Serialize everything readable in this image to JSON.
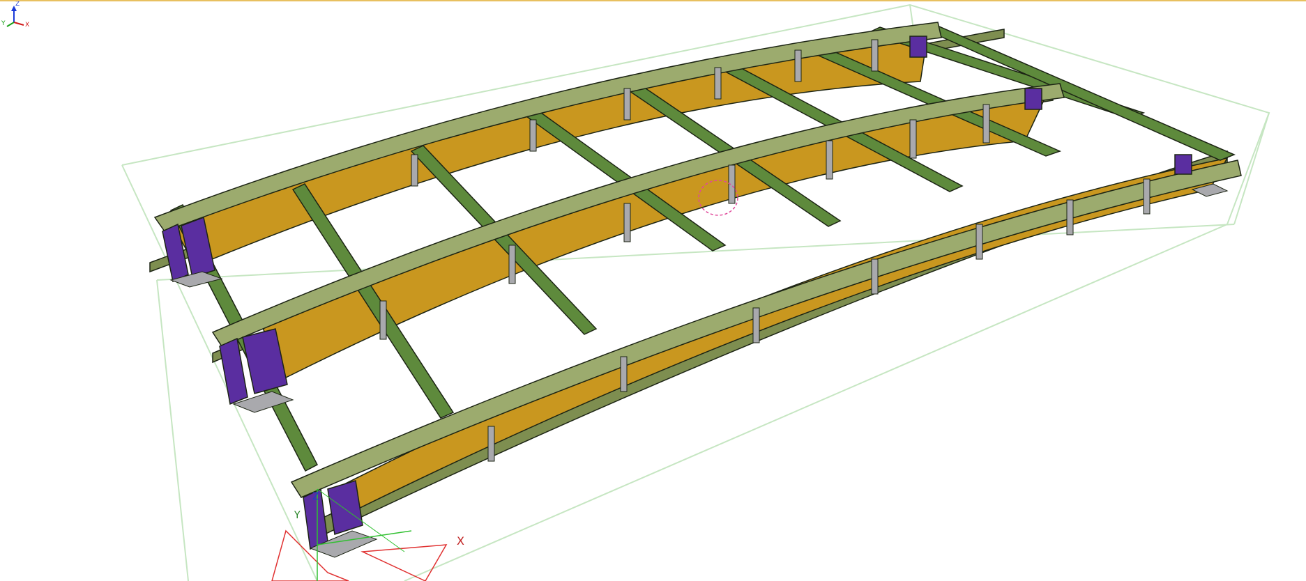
{
  "viewport": {
    "colors": {
      "web": "#c9971f",
      "top_flange": "#9cab6e",
      "secondary_beam": "#5e8a3c",
      "beam_dark": "#3c5a24",
      "end_plate": "#5a2ea0",
      "stiffener": "#a9a9ad",
      "bounding_box": "#c6e6c2",
      "outline": "#1c2414",
      "selection": "#e0489a"
    },
    "axis_labels": {
      "x": "X",
      "y": "Y",
      "z": "Z"
    },
    "view_triad": {
      "x": "X",
      "y": "Y",
      "z": "Z"
    }
  }
}
